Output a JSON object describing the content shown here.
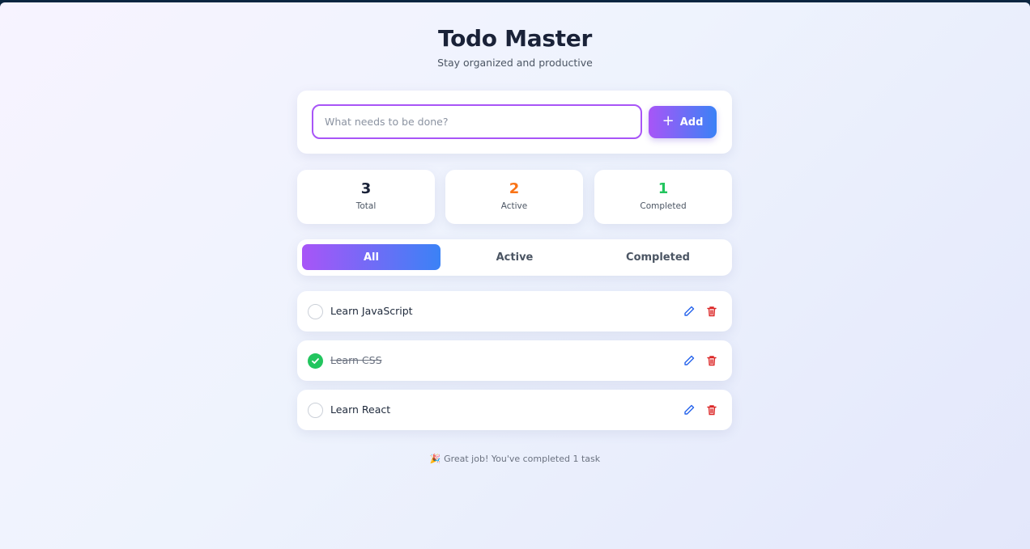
{
  "header": {
    "title": "Todo Master",
    "subtitle": "Stay organized and productive"
  },
  "input": {
    "placeholder": "What needs to be done?",
    "value": "",
    "add_label": "Add",
    "add_icon": "plus-icon"
  },
  "stats": [
    {
      "value": "3",
      "label": "Total",
      "color": "#1a2238"
    },
    {
      "value": "2",
      "label": "Active",
      "color": "#f97316"
    },
    {
      "value": "1",
      "label": "Completed",
      "color": "#22c55e"
    }
  ],
  "filters": [
    {
      "label": "All",
      "selected": true
    },
    {
      "label": "Active",
      "selected": false
    },
    {
      "label": "Completed",
      "selected": false
    }
  ],
  "todos": [
    {
      "text": "Learn JavaScript",
      "completed": false
    },
    {
      "text": "Learn CSS",
      "completed": true
    },
    {
      "text": "Learn React",
      "completed": false
    }
  ],
  "icons": {
    "edit": "pencil-icon",
    "delete": "trash-icon",
    "check": "checkmark-icon",
    "footer": "party-popper-icon"
  },
  "colors": {
    "accent_start": "#a855f7",
    "accent_end": "#3b82f6",
    "edit": "#2563eb",
    "delete": "#dc2626",
    "done": "#22c55e"
  },
  "footer": {
    "emoji": "🎉",
    "message": "Great job! You've completed 1 task"
  }
}
